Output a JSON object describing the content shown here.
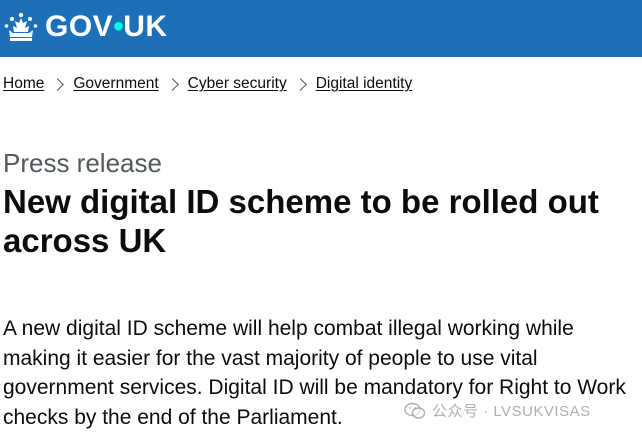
{
  "header": {
    "logo_text_left": "GOV",
    "logo_dot": "•",
    "logo_text_right": "UK",
    "logo_icon": "crown-icon",
    "brand_color": "#1d70b8",
    "dot_color": "#00ffe0"
  },
  "breadcrumbs": [
    {
      "label": "Home"
    },
    {
      "label": "Government"
    },
    {
      "label": "Cyber security"
    },
    {
      "label": "Digital identity"
    }
  ],
  "page": {
    "caption": "Press release",
    "title": "New digital ID scheme to be rolled out across UK",
    "lede": "A new digital ID scheme will help combat illegal working while making it easier for the vast majority of people to use vital government services. Digital ID will be mandatory for Right to Work checks by the end of the Parliament."
  },
  "watermark": {
    "text": "公众号 · LVSUKVISAS",
    "icon": "wechat-icon"
  }
}
